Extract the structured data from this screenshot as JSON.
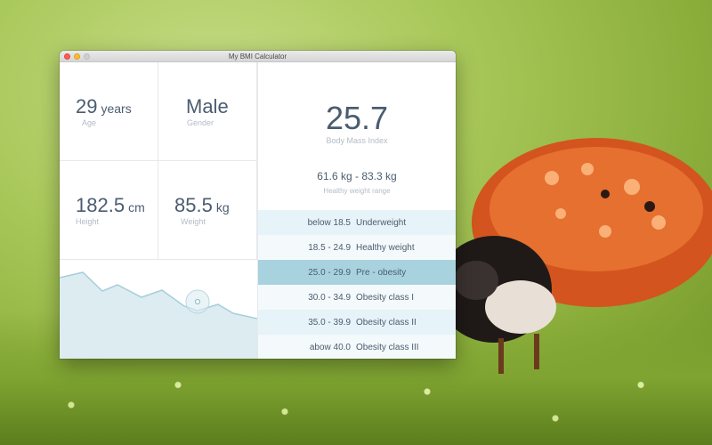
{
  "window": {
    "title": "My BMI Calculator"
  },
  "inputs": {
    "age": {
      "value": "29",
      "unit": "years",
      "label": "Age"
    },
    "gender": {
      "value": "Male",
      "label": "Gender"
    },
    "height": {
      "value": "182.5",
      "unit": "cm",
      "label": "Height"
    },
    "weight": {
      "value": "85.5",
      "unit": "kg",
      "label": "Weight"
    }
  },
  "result": {
    "bmi": "25.7",
    "bmi_label": "Body Mass Index",
    "healthy_range": "61.6 kg  -  83.3 kg",
    "healthy_range_label": "Healthy weight range"
  },
  "categories": [
    {
      "range": "below  18.5",
      "name": "Underweight",
      "active": false
    },
    {
      "range": "18.5  -  24.9",
      "name": "Healthy weight",
      "active": false
    },
    {
      "range": "25.0  -  29.9",
      "name": "Pre - obesity",
      "active": true
    },
    {
      "range": "30.0  -  34.9",
      "name": "Obesity class I",
      "active": false
    },
    {
      "range": "35.0  -  39.9",
      "name": "Obesity class II",
      "active": false
    },
    {
      "range": "abow  40.0",
      "name": "Obesity class III",
      "active": false
    }
  ],
  "colors": {
    "accent": "#a8d3de",
    "text": "#4b5c70",
    "label": "#b3bcc6",
    "chart_fill": "#dcecf1",
    "chart_line": "#a6cedb"
  }
}
